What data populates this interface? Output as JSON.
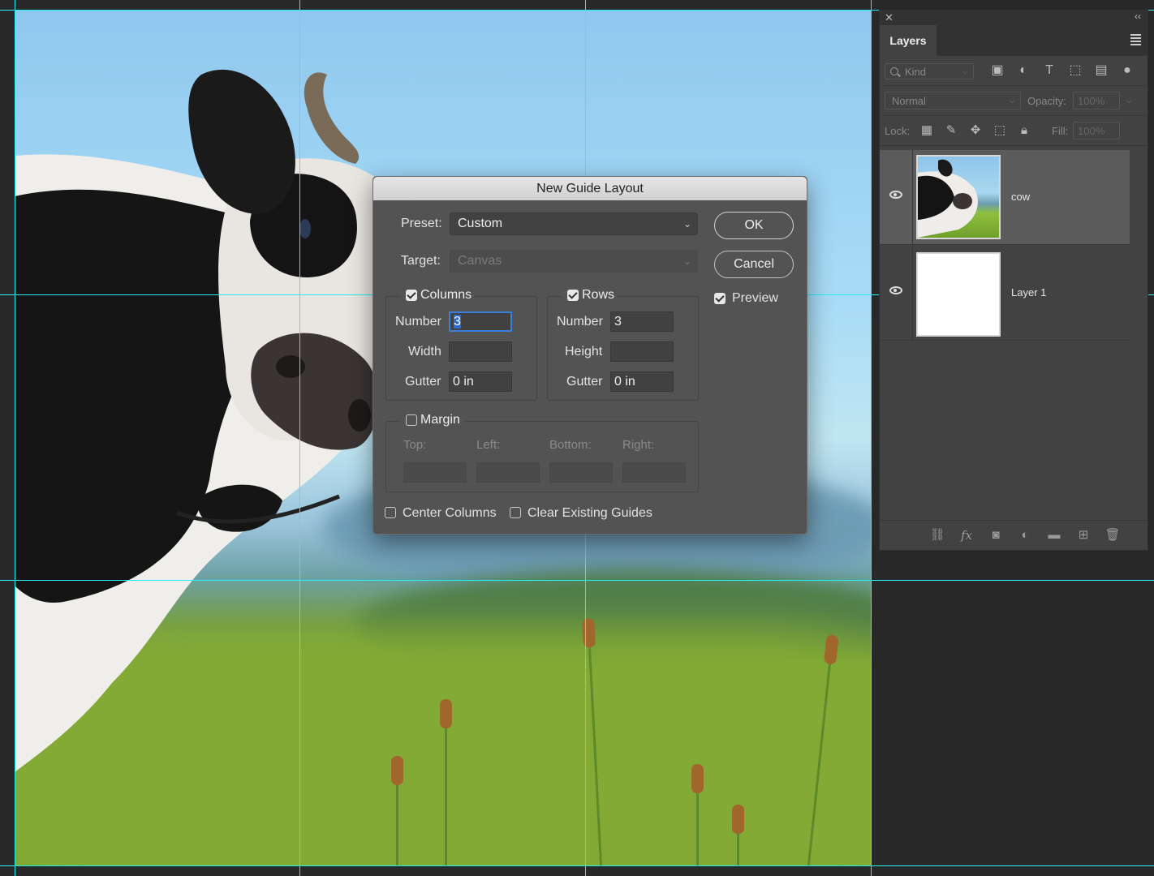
{
  "dialog": {
    "title": "New Guide Layout",
    "preset_label": "Preset:",
    "preset_value": "Custom",
    "target_label": "Target:",
    "target_value": "Canvas",
    "ok_label": "OK",
    "cancel_label": "Cancel",
    "preview_label": "Preview",
    "preview_checked": true,
    "columns": {
      "label": "Columns",
      "checked": true,
      "number_label": "Number",
      "number_value": "3",
      "width_label": "Width",
      "width_value": "",
      "gutter_label": "Gutter",
      "gutter_value": "0 in"
    },
    "rows": {
      "label": "Rows",
      "checked": true,
      "number_label": "Number",
      "number_value": "3",
      "height_label": "Height",
      "height_value": "",
      "gutter_label": "Gutter",
      "gutter_value": "0 in"
    },
    "margin": {
      "label": "Margin",
      "checked": false,
      "top_label": "Top:",
      "left_label": "Left:",
      "bottom_label": "Bottom:",
      "right_label": "Right:"
    },
    "center_columns_label": "Center Columns",
    "clear_guides_label": "Clear Existing Guides"
  },
  "layers_panel": {
    "tab_label": "Layers",
    "kind_label": "Kind",
    "blend_mode": "Normal",
    "opacity_label": "Opacity:",
    "opacity_value": "100%",
    "lock_label": "Lock:",
    "fill_label": "Fill:",
    "fill_value": "100%",
    "filter_icons": [
      "image-filter-icon",
      "adjustment-filter-icon",
      "type-filter-icon",
      "shape-filter-icon",
      "smart-object-filter-icon",
      "filter-toggle-icon"
    ],
    "lock_icons": [
      "lock-transparent-icon",
      "lock-image-icon",
      "lock-position-icon",
      "lock-artboard-icon",
      "lock-all-icon"
    ],
    "footer_icons": [
      "link-icon",
      "fx-icon",
      "mask-icon",
      "adjustment-icon",
      "folder-icon",
      "new-layer-icon",
      "trash-icon"
    ],
    "layers": [
      {
        "name": "cow",
        "selected": true,
        "visible": true
      },
      {
        "name": "Layer 1",
        "selected": false,
        "visible": true
      }
    ]
  },
  "colors": {
    "guide": "#23f0f0",
    "focus": "#3b80d8"
  }
}
